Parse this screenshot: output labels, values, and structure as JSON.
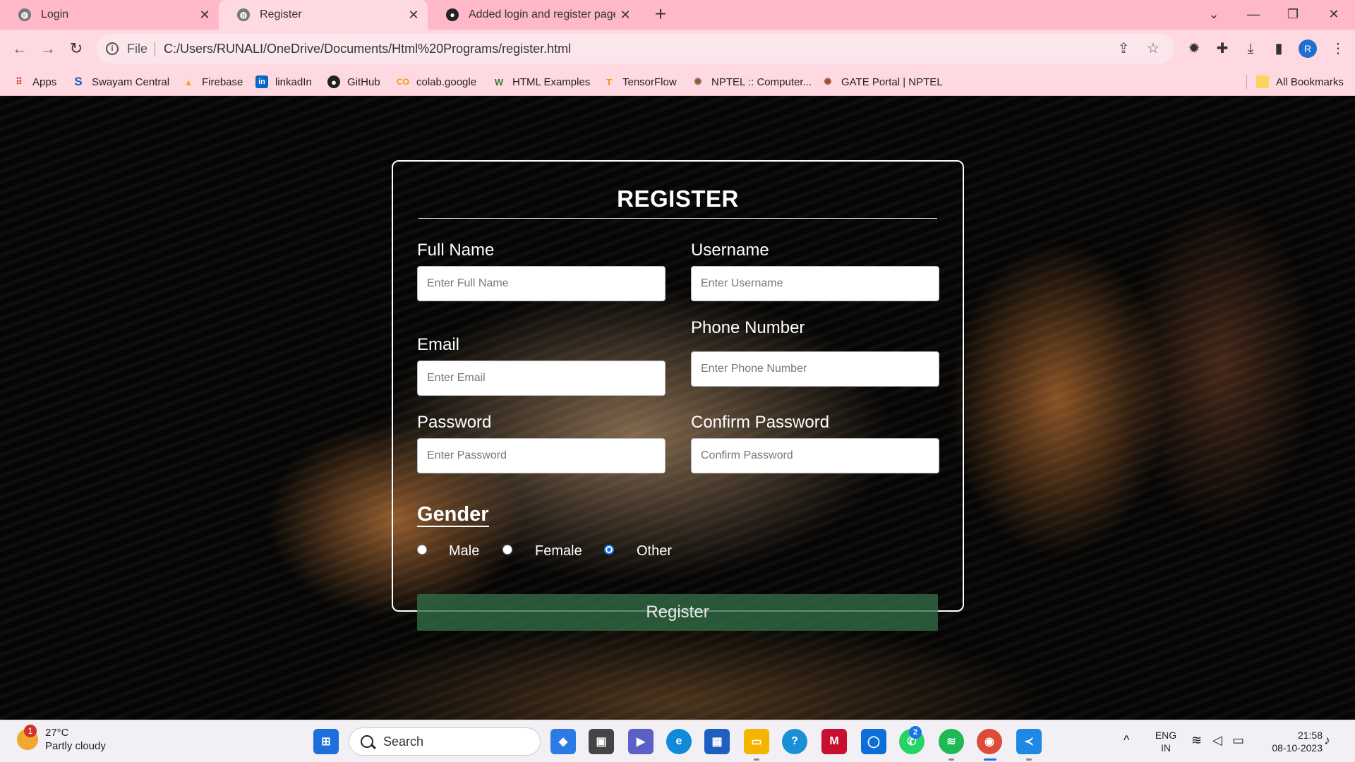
{
  "browser": {
    "tabs": [
      {
        "label": "Login",
        "active": false
      },
      {
        "label": "Register",
        "active": true
      },
      {
        "label": "Added login and register pages",
        "active": false
      }
    ],
    "new_tab_icon": "plus-icon",
    "address": {
      "scheme": "File",
      "url": "C:/Users/RUNALI/OneDrive/Documents/Html%20Programs/register.html"
    },
    "profile_initial": "R",
    "bookmarks": [
      {
        "label": "Apps"
      },
      {
        "label": "Swayam Central"
      },
      {
        "label": "Firebase"
      },
      {
        "label": "linkadIn"
      },
      {
        "label": "GitHub"
      },
      {
        "label": "colab.google"
      },
      {
        "label": "HTML Examples"
      },
      {
        "label": "TensorFlow"
      },
      {
        "label": "NPTEL :: Computer..."
      },
      {
        "label": "GATE Portal | NPTEL"
      }
    ],
    "all_bookmarks": "All Bookmarks"
  },
  "form": {
    "title": "REGISTER",
    "fields": {
      "full_name": {
        "label": "Full Name",
        "placeholder": "Enter Full Name"
      },
      "username": {
        "label": "Username",
        "placeholder": "Enter Username"
      },
      "email": {
        "label": "Email",
        "placeholder": "Enter Email"
      },
      "phone": {
        "label": "Phone Number",
        "placeholder": "Enter Phone Number"
      },
      "password": {
        "label": "Password",
        "placeholder": "Enter Password"
      },
      "confirm_password": {
        "label": "Confirm Password",
        "placeholder": "Confirm Password"
      }
    },
    "gender": {
      "label": "Gender",
      "options": [
        "Male",
        "Female",
        "Other"
      ],
      "selected": "Other"
    },
    "submit_label": "Register",
    "submit_color": "#326e46"
  },
  "taskbar": {
    "weather": {
      "temp": "27°C",
      "desc": "Partly cloudy",
      "badge": "1"
    },
    "search_label": "Search",
    "whatsapp_badge": "2",
    "language": "ENG",
    "region": "IN",
    "time": "21:58",
    "date": "08-10-2023"
  }
}
